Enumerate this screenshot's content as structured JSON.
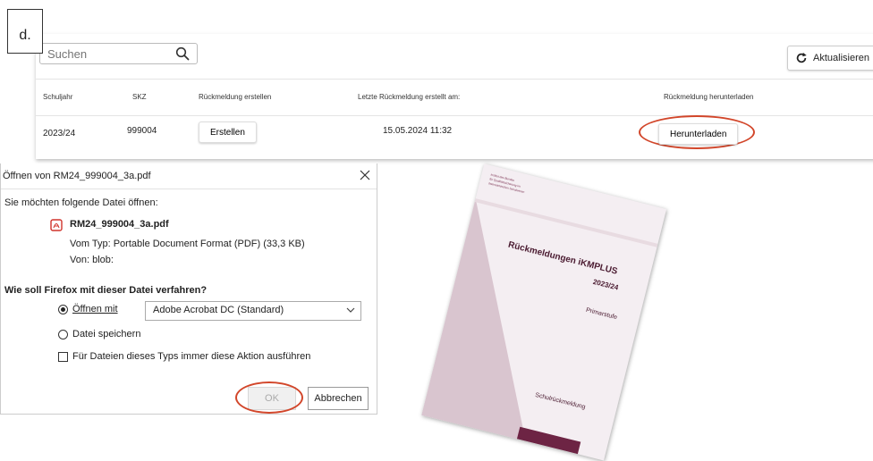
{
  "step": {
    "label": "d."
  },
  "search": {
    "placeholder": "Suchen"
  },
  "toolbar": {
    "refresh_label": "Aktualisieren"
  },
  "table": {
    "headers": [
      "Schuljahr",
      "SKZ",
      "Rückmeldung erstellen",
      "Letzte Rückmeldung erstellt am:",
      "Rückmeldung herunterladen"
    ],
    "rows": [
      {
        "year": "2023/24",
        "skz": "999004",
        "create": "Erstellen",
        "date": "15.05.2024 11:32",
        "download": "Herunterladen"
      }
    ]
  },
  "dialog": {
    "title": "Öffnen von RM24_999004_3a.pdf",
    "intro": "Sie möchten folgende Datei öffnen:",
    "filename": "RM24_999004_3a.pdf",
    "type_line": "Vom Typ: Portable Document Format (PDF) (33,3 KB)",
    "from_line": "Von:  blob:",
    "question": "Wie soll Firefox mit dieser Datei verfahren?",
    "open_with": "Öffnen mit",
    "app": "Adobe Acrobat DC (Standard)",
    "save": "Datei speichern",
    "always": "Für Dateien dieses Typs immer diese Aktion ausführen",
    "ok": "OK",
    "cancel": "Abbrechen"
  },
  "cover": {
    "logo_lines": [
      "Institut des Bundes",
      "für Qualitätssicherung im",
      "österreichischen Schulwesen"
    ],
    "title": "Rückmeldungen iKMPLUS",
    "year": "2023/24",
    "subtitle": "Primarstufe",
    "footer": "Schulrückmeldung"
  },
  "colors": {
    "highlight": "#d2462a",
    "pdf_red": "#d0342c",
    "cover_accent": "#6d2444"
  }
}
